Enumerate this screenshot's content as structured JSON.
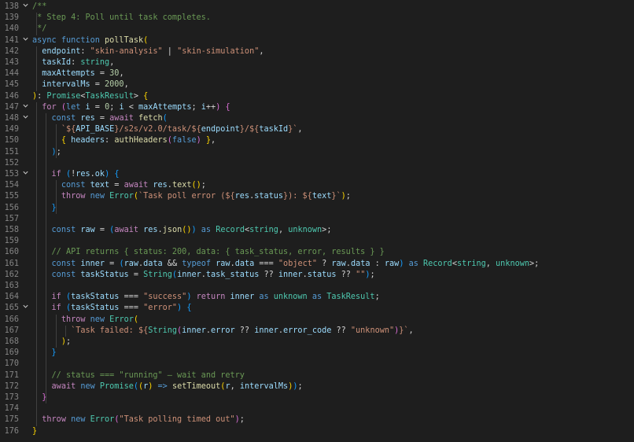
{
  "editor": {
    "line_numbers": [
      "138",
      "139",
      "140",
      "141",
      "142",
      "143",
      "144",
      "145",
      "146",
      "147",
      "148",
      "149",
      "150",
      "151",
      "152",
      "153",
      "154",
      "155",
      "156",
      "157",
      "158",
      "159",
      "160",
      "161",
      "162",
      "163",
      "164",
      "165",
      "166",
      "167",
      "168",
      "169",
      "170",
      "171",
      "172",
      "173",
      "174",
      "175",
      "176"
    ],
    "lines": [
      [
        {
          "t": "/**",
          "c": "c"
        }
      ],
      [
        {
          "t": " * Step 4: Poll until task completes.",
          "c": "c"
        }
      ],
      [
        {
          "t": " */",
          "c": "c"
        }
      ],
      [
        {
          "t": "async ",
          "c": "k"
        },
        {
          "t": "function ",
          "c": "k"
        },
        {
          "t": "pollTask",
          "c": "f"
        },
        {
          "t": "(",
          "c": "br1"
        }
      ],
      [
        {
          "t": "  ",
          "c": "p"
        },
        {
          "t": "endpoint",
          "c": "v"
        },
        {
          "t": ": ",
          "c": "p"
        },
        {
          "t": "\"skin-analysis\"",
          "c": "s"
        },
        {
          "t": " | ",
          "c": "p"
        },
        {
          "t": "\"skin-simulation\"",
          "c": "s"
        },
        {
          "t": ",",
          "c": "p"
        }
      ],
      [
        {
          "t": "  ",
          "c": "p"
        },
        {
          "t": "taskId",
          "c": "v"
        },
        {
          "t": ": ",
          "c": "p"
        },
        {
          "t": "string",
          "c": "t"
        },
        {
          "t": ",",
          "c": "p"
        }
      ],
      [
        {
          "t": "  ",
          "c": "p"
        },
        {
          "t": "maxAttempts",
          "c": "v"
        },
        {
          "t": " = ",
          "c": "p"
        },
        {
          "t": "30",
          "c": "n"
        },
        {
          "t": ",",
          "c": "p"
        }
      ],
      [
        {
          "t": "  ",
          "c": "p"
        },
        {
          "t": "intervalMs",
          "c": "v"
        },
        {
          "t": " = ",
          "c": "p"
        },
        {
          "t": "2000",
          "c": "n"
        },
        {
          "t": ",",
          "c": "p"
        }
      ],
      [
        {
          "t": ")",
          "c": "br1"
        },
        {
          "t": ": ",
          "c": "p"
        },
        {
          "t": "Promise",
          "c": "t"
        },
        {
          "t": "<",
          "c": "p"
        },
        {
          "t": "TaskResult",
          "c": "t"
        },
        {
          "t": "> ",
          "c": "p"
        },
        {
          "t": "{",
          "c": "br1"
        }
      ],
      [
        {
          "t": "  ",
          "c": "p"
        },
        {
          "t": "for ",
          "c": "kc"
        },
        {
          "t": "(",
          "c": "br2"
        },
        {
          "t": "let ",
          "c": "k"
        },
        {
          "t": "i",
          "c": "v"
        },
        {
          "t": " = ",
          "c": "p"
        },
        {
          "t": "0",
          "c": "n"
        },
        {
          "t": "; ",
          "c": "p"
        },
        {
          "t": "i",
          "c": "v"
        },
        {
          "t": " < ",
          "c": "p"
        },
        {
          "t": "maxAttempts",
          "c": "v"
        },
        {
          "t": "; ",
          "c": "p"
        },
        {
          "t": "i",
          "c": "v"
        },
        {
          "t": "++",
          "c": "p"
        },
        {
          "t": ") ",
          "c": "br2"
        },
        {
          "t": "{",
          "c": "br2"
        }
      ],
      [
        {
          "t": "    ",
          "c": "p"
        },
        {
          "t": "const ",
          "c": "k"
        },
        {
          "t": "res",
          "c": "v"
        },
        {
          "t": " = ",
          "c": "p"
        },
        {
          "t": "await ",
          "c": "kc"
        },
        {
          "t": "fetch",
          "c": "f"
        },
        {
          "t": "(",
          "c": "br3"
        }
      ],
      [
        {
          "t": "      ",
          "c": "p"
        },
        {
          "t": "`${",
          "c": "s"
        },
        {
          "t": "API_BASE",
          "c": "v"
        },
        {
          "t": "}/s2s/v2.0/task/${",
          "c": "s"
        },
        {
          "t": "endpoint",
          "c": "v"
        },
        {
          "t": "}/${",
          "c": "s"
        },
        {
          "t": "taskId",
          "c": "v"
        },
        {
          "t": "}`",
          "c": "s"
        },
        {
          "t": ",",
          "c": "p"
        }
      ],
      [
        {
          "t": "      ",
          "c": "p"
        },
        {
          "t": "{ ",
          "c": "br1"
        },
        {
          "t": "headers",
          "c": "v"
        },
        {
          "t": ": ",
          "c": "p"
        },
        {
          "t": "authHeaders",
          "c": "f"
        },
        {
          "t": "(",
          "c": "br2"
        },
        {
          "t": "false",
          "c": "k"
        },
        {
          "t": ")",
          "c": "br2"
        },
        {
          "t": " }",
          "c": "br1"
        },
        {
          "t": ",",
          "c": "p"
        }
      ],
      [
        {
          "t": "    ",
          "c": "p"
        },
        {
          "t": ")",
          "c": "br3"
        },
        {
          "t": ";",
          "c": "p"
        }
      ],
      [
        {
          "t": "",
          "c": "p"
        }
      ],
      [
        {
          "t": "    ",
          "c": "p"
        },
        {
          "t": "if ",
          "c": "kc"
        },
        {
          "t": "(",
          "c": "br3"
        },
        {
          "t": "!",
          "c": "p"
        },
        {
          "t": "res",
          "c": "v"
        },
        {
          "t": ".",
          "c": "p"
        },
        {
          "t": "ok",
          "c": "v"
        },
        {
          "t": ") ",
          "c": "br3"
        },
        {
          "t": "{",
          "c": "br3"
        }
      ],
      [
        {
          "t": "      ",
          "c": "p"
        },
        {
          "t": "const ",
          "c": "k"
        },
        {
          "t": "text",
          "c": "v"
        },
        {
          "t": " = ",
          "c": "p"
        },
        {
          "t": "await ",
          "c": "kc"
        },
        {
          "t": "res",
          "c": "v"
        },
        {
          "t": ".",
          "c": "p"
        },
        {
          "t": "text",
          "c": "f"
        },
        {
          "t": "()",
          "c": "br1"
        },
        {
          "t": ";",
          "c": "p"
        }
      ],
      [
        {
          "t": "      ",
          "c": "p"
        },
        {
          "t": "throw ",
          "c": "kc"
        },
        {
          "t": "new ",
          "c": "k"
        },
        {
          "t": "Error",
          "c": "t"
        },
        {
          "t": "(",
          "c": "br1"
        },
        {
          "t": "`Task poll error (${",
          "c": "s"
        },
        {
          "t": "res",
          "c": "v"
        },
        {
          "t": ".",
          "c": "p"
        },
        {
          "t": "status",
          "c": "v"
        },
        {
          "t": "}): ${",
          "c": "s"
        },
        {
          "t": "text",
          "c": "v"
        },
        {
          "t": "}`",
          "c": "s"
        },
        {
          "t": ")",
          "c": "br1"
        },
        {
          "t": ";",
          "c": "p"
        }
      ],
      [
        {
          "t": "    ",
          "c": "p"
        },
        {
          "t": "}",
          "c": "br3"
        }
      ],
      [
        {
          "t": "",
          "c": "p"
        }
      ],
      [
        {
          "t": "    ",
          "c": "p"
        },
        {
          "t": "const ",
          "c": "k"
        },
        {
          "t": "raw",
          "c": "v"
        },
        {
          "t": " = ",
          "c": "p"
        },
        {
          "t": "(",
          "c": "br3"
        },
        {
          "t": "await ",
          "c": "kc"
        },
        {
          "t": "res",
          "c": "v"
        },
        {
          "t": ".",
          "c": "p"
        },
        {
          "t": "json",
          "c": "f"
        },
        {
          "t": "()",
          "c": "br1"
        },
        {
          "t": ")",
          "c": "br3"
        },
        {
          "t": " as ",
          "c": "k"
        },
        {
          "t": "Record",
          "c": "t"
        },
        {
          "t": "<",
          "c": "p"
        },
        {
          "t": "string",
          "c": "t"
        },
        {
          "t": ", ",
          "c": "p"
        },
        {
          "t": "unknown",
          "c": "t"
        },
        {
          "t": ">",
          "c": "p"
        },
        {
          "t": ";",
          "c": "p"
        }
      ],
      [
        {
          "t": "",
          "c": "p"
        }
      ],
      [
        {
          "t": "    ",
          "c": "p"
        },
        {
          "t": "// API returns { status: 200, data: { task_status, error, results } }",
          "c": "c"
        }
      ],
      [
        {
          "t": "    ",
          "c": "p"
        },
        {
          "t": "const ",
          "c": "k"
        },
        {
          "t": "inner",
          "c": "v"
        },
        {
          "t": " = ",
          "c": "p"
        },
        {
          "t": "(",
          "c": "br3"
        },
        {
          "t": "raw",
          "c": "v"
        },
        {
          "t": ".",
          "c": "p"
        },
        {
          "t": "data",
          "c": "v"
        },
        {
          "t": " && ",
          "c": "p"
        },
        {
          "t": "typeof ",
          "c": "k"
        },
        {
          "t": "raw",
          "c": "v"
        },
        {
          "t": ".",
          "c": "p"
        },
        {
          "t": "data",
          "c": "v"
        },
        {
          "t": " === ",
          "c": "p"
        },
        {
          "t": "\"object\"",
          "c": "s"
        },
        {
          "t": " ? ",
          "c": "p"
        },
        {
          "t": "raw",
          "c": "v"
        },
        {
          "t": ".",
          "c": "p"
        },
        {
          "t": "data",
          "c": "v"
        },
        {
          "t": " : ",
          "c": "p"
        },
        {
          "t": "raw",
          "c": "v"
        },
        {
          "t": ")",
          "c": "br3"
        },
        {
          "t": " as ",
          "c": "k"
        },
        {
          "t": "Record",
          "c": "t"
        },
        {
          "t": "<",
          "c": "p"
        },
        {
          "t": "string",
          "c": "t"
        },
        {
          "t": ", ",
          "c": "p"
        },
        {
          "t": "unknown",
          "c": "t"
        },
        {
          "t": ">",
          "c": "p"
        },
        {
          "t": ";",
          "c": "p"
        }
      ],
      [
        {
          "t": "    ",
          "c": "p"
        },
        {
          "t": "const ",
          "c": "k"
        },
        {
          "t": "taskStatus",
          "c": "v"
        },
        {
          "t": " = ",
          "c": "p"
        },
        {
          "t": "String",
          "c": "t"
        },
        {
          "t": "(",
          "c": "br3"
        },
        {
          "t": "inner",
          "c": "v"
        },
        {
          "t": ".",
          "c": "p"
        },
        {
          "t": "task_status",
          "c": "v"
        },
        {
          "t": " ?? ",
          "c": "p"
        },
        {
          "t": "inner",
          "c": "v"
        },
        {
          "t": ".",
          "c": "p"
        },
        {
          "t": "status",
          "c": "v"
        },
        {
          "t": " ?? ",
          "c": "p"
        },
        {
          "t": "\"\"",
          "c": "s"
        },
        {
          "t": ")",
          "c": "br3"
        },
        {
          "t": ";",
          "c": "p"
        }
      ],
      [
        {
          "t": "",
          "c": "p"
        }
      ],
      [
        {
          "t": "    ",
          "c": "p"
        },
        {
          "t": "if ",
          "c": "kc"
        },
        {
          "t": "(",
          "c": "br3"
        },
        {
          "t": "taskStatus",
          "c": "v"
        },
        {
          "t": " === ",
          "c": "p"
        },
        {
          "t": "\"success\"",
          "c": "s"
        },
        {
          "t": ")",
          "c": "br3"
        },
        {
          "t": " return ",
          "c": "kc"
        },
        {
          "t": "inner",
          "c": "v"
        },
        {
          "t": " as ",
          "c": "k"
        },
        {
          "t": "unknown",
          "c": "t"
        },
        {
          "t": " as ",
          "c": "k"
        },
        {
          "t": "TaskResult",
          "c": "t"
        },
        {
          "t": ";",
          "c": "p"
        }
      ],
      [
        {
          "t": "    ",
          "c": "p"
        },
        {
          "t": "if ",
          "c": "kc"
        },
        {
          "t": "(",
          "c": "br3"
        },
        {
          "t": "taskStatus",
          "c": "v"
        },
        {
          "t": " === ",
          "c": "p"
        },
        {
          "t": "\"error\"",
          "c": "s"
        },
        {
          "t": ") ",
          "c": "br3"
        },
        {
          "t": "{",
          "c": "br3"
        }
      ],
      [
        {
          "t": "      ",
          "c": "p"
        },
        {
          "t": "throw ",
          "c": "kc"
        },
        {
          "t": "new ",
          "c": "k"
        },
        {
          "t": "Error",
          "c": "t"
        },
        {
          "t": "(",
          "c": "br1"
        }
      ],
      [
        {
          "t": "        ",
          "c": "p"
        },
        {
          "t": "`Task failed: ${",
          "c": "s"
        },
        {
          "t": "String",
          "c": "t"
        },
        {
          "t": "(",
          "c": "br2"
        },
        {
          "t": "inner",
          "c": "v"
        },
        {
          "t": ".",
          "c": "p"
        },
        {
          "t": "error",
          "c": "v"
        },
        {
          "t": " ?? ",
          "c": "p"
        },
        {
          "t": "inner",
          "c": "v"
        },
        {
          "t": ".",
          "c": "p"
        },
        {
          "t": "error_code",
          "c": "v"
        },
        {
          "t": " ?? ",
          "c": "p"
        },
        {
          "t": "\"unknown\"",
          "c": "s"
        },
        {
          "t": ")",
          "c": "br2"
        },
        {
          "t": "}`",
          "c": "s"
        },
        {
          "t": ",",
          "c": "p"
        }
      ],
      [
        {
          "t": "      ",
          "c": "p"
        },
        {
          "t": ")",
          "c": "br1"
        },
        {
          "t": ";",
          "c": "p"
        }
      ],
      [
        {
          "t": "    ",
          "c": "p"
        },
        {
          "t": "}",
          "c": "br3"
        }
      ],
      [
        {
          "t": "",
          "c": "p"
        }
      ],
      [
        {
          "t": "    ",
          "c": "p"
        },
        {
          "t": "// status === \"running\" — wait and retry",
          "c": "c"
        }
      ],
      [
        {
          "t": "    ",
          "c": "p"
        },
        {
          "t": "await ",
          "c": "kc"
        },
        {
          "t": "new ",
          "c": "k"
        },
        {
          "t": "Promise",
          "c": "t"
        },
        {
          "t": "(",
          "c": "br3"
        },
        {
          "t": "(",
          "c": "br1"
        },
        {
          "t": "r",
          "c": "v"
        },
        {
          "t": ")",
          "c": "br1"
        },
        {
          "t": " => ",
          "c": "k"
        },
        {
          "t": "setTimeout",
          "c": "f"
        },
        {
          "t": "(",
          "c": "br1"
        },
        {
          "t": "r",
          "c": "v"
        },
        {
          "t": ", ",
          "c": "p"
        },
        {
          "t": "intervalMs",
          "c": "v"
        },
        {
          "t": ")",
          "c": "br1"
        },
        {
          "t": ")",
          "c": "br3"
        },
        {
          "t": ";",
          "c": "p"
        }
      ],
      [
        {
          "t": "  ",
          "c": "p"
        },
        {
          "t": "}",
          "c": "br2"
        }
      ],
      [
        {
          "t": "",
          "c": "p"
        }
      ],
      [
        {
          "t": "  ",
          "c": "p"
        },
        {
          "t": "throw ",
          "c": "kc"
        },
        {
          "t": "new ",
          "c": "k"
        },
        {
          "t": "Error",
          "c": "t"
        },
        {
          "t": "(",
          "c": "br2"
        },
        {
          "t": "\"Task polling timed out\"",
          "c": "s"
        },
        {
          "t": ")",
          "c": "br2"
        },
        {
          "t": ";",
          "c": "p"
        }
      ],
      [
        {
          "t": "}",
          "c": "br1"
        }
      ]
    ],
    "fold_markers": {
      "0": "chevron-down",
      "3": "chevron-down",
      "9": "chevron-down",
      "10": "chevron-down",
      "15": "chevron-down",
      "27": "chevron-down"
    },
    "guides": [
      {
        "col": 1,
        "from": 1,
        "to": 2
      },
      {
        "col": 1,
        "from": 4,
        "to": 7
      },
      {
        "col": 1,
        "from": 9,
        "to": 37
      },
      {
        "col": 3,
        "from": 10,
        "to": 35
      },
      {
        "col": 5,
        "from": 11,
        "to": 13
      },
      {
        "col": 5,
        "from": 16,
        "to": 18
      },
      {
        "col": 5,
        "from": 28,
        "to": 30
      },
      {
        "col": 7,
        "from": 29,
        "to": 29
      }
    ]
  }
}
